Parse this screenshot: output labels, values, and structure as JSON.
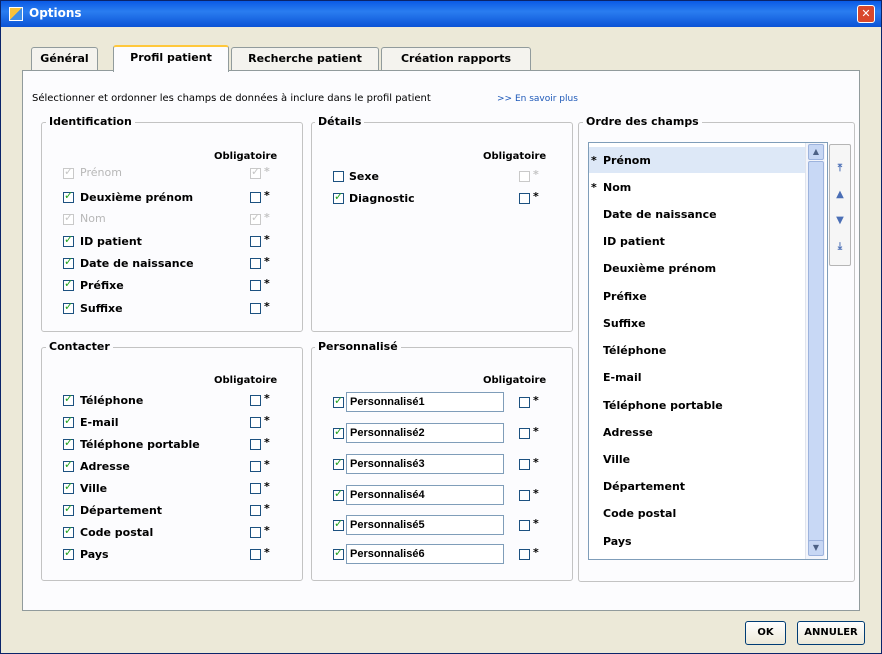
{
  "window": {
    "title": "Options"
  },
  "tabs": [
    {
      "label": "Général"
    },
    {
      "label": "Profil patient"
    },
    {
      "label": "Recherche patient"
    },
    {
      "label": "Création rapports"
    }
  ],
  "instruction": "Sélectionner et ordonner les champs de données à inclure dans le profil patient",
  "learn_more": ">> En savoir plus",
  "obligatoire_label": "Obligatoire",
  "mandatory_marker": "*",
  "identification": {
    "title": "Identification",
    "items": [
      {
        "label": "Prénom"
      },
      {
        "label": "Deuxième prénom"
      },
      {
        "label": "Nom"
      },
      {
        "label": "ID patient"
      },
      {
        "label": "Date de naissance"
      },
      {
        "label": "Préfixe"
      },
      {
        "label": "Suffixe"
      }
    ]
  },
  "details": {
    "title": "Détails",
    "items": [
      {
        "label": "Sexe"
      },
      {
        "label": "Diagnostic"
      }
    ]
  },
  "contacter": {
    "title": "Contacter",
    "items": [
      {
        "label": "Téléphone"
      },
      {
        "label": "E-mail"
      },
      {
        "label": "Téléphone portable"
      },
      {
        "label": "Adresse"
      },
      {
        "label": "Ville"
      },
      {
        "label": "Département"
      },
      {
        "label": "Code postal"
      },
      {
        "label": "Pays"
      }
    ]
  },
  "personnalise": {
    "title": "Personnalisé",
    "items": [
      {
        "value": "Personnalisé1"
      },
      {
        "value": "Personnalisé2"
      },
      {
        "value": "Personnalisé3"
      },
      {
        "value": "Personnalisé4"
      },
      {
        "value": "Personnalisé5"
      },
      {
        "value": "Personnalisé6"
      }
    ]
  },
  "ordre": {
    "title": "Ordre des champs",
    "items": [
      {
        "label": "Prénom"
      },
      {
        "label": "Nom"
      },
      {
        "label": "Date de naissance"
      },
      {
        "label": "ID patient"
      },
      {
        "label": "Deuxième prénom"
      },
      {
        "label": "Préfixe"
      },
      {
        "label": "Suffixe"
      },
      {
        "label": "Téléphone"
      },
      {
        "label": "E-mail"
      },
      {
        "label": "Téléphone portable"
      },
      {
        "label": "Adresse"
      },
      {
        "label": "Ville"
      },
      {
        "label": "Département"
      },
      {
        "label": "Code postal"
      },
      {
        "label": "Pays"
      }
    ]
  },
  "buttons": {
    "ok": "OK",
    "cancel": "ANNULER"
  },
  "colors": {
    "title_bar": "#0a5ae6",
    "check_mark": "#21a121",
    "link": "#1d58b8",
    "selected_row": "#dde8f7"
  }
}
